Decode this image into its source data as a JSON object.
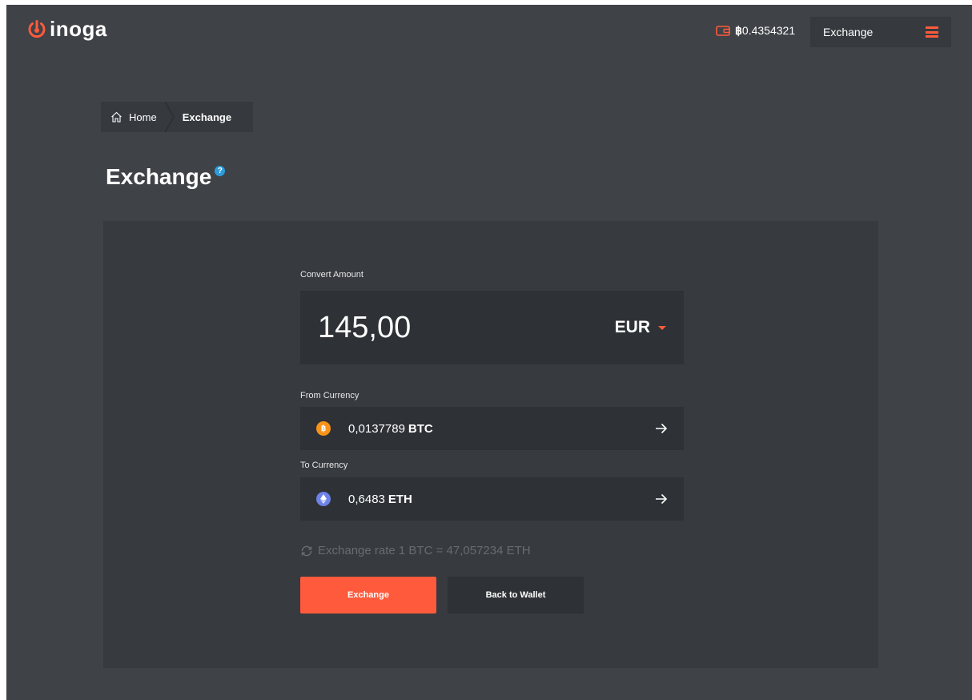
{
  "brand": {
    "name": "inoga",
    "accent": "#ff5a3c"
  },
  "header": {
    "wallet_symbol": "฿",
    "wallet_balance": "0.4354321",
    "nav_select_label": "Exchange"
  },
  "breadcrumb": {
    "home_label": "Home",
    "current_label": "Exchange"
  },
  "page": {
    "title": "Exchange",
    "help_symbol": "?"
  },
  "form": {
    "convert_label": "Convert Amount",
    "amount": "145,00",
    "amount_currency": "EUR",
    "from_label": "From Currency",
    "from_amount": "0,0137789",
    "from_code": "BTC",
    "from_icon_glyph": "฿",
    "to_label": "To Currency",
    "to_amount": "0,6483",
    "to_code": "ETH",
    "rate_text": "Exchange rate 1 BTC = 47,057234 ETH"
  },
  "actions": {
    "exchange_label": "Exchange",
    "back_label": "Back to Wallet"
  },
  "colors": {
    "btc": "#f7931a",
    "eth": "#6d83e8",
    "help": "#2d9cdb",
    "background": "#3f4247",
    "panel": "#373a3f",
    "field": "#2e3135"
  }
}
